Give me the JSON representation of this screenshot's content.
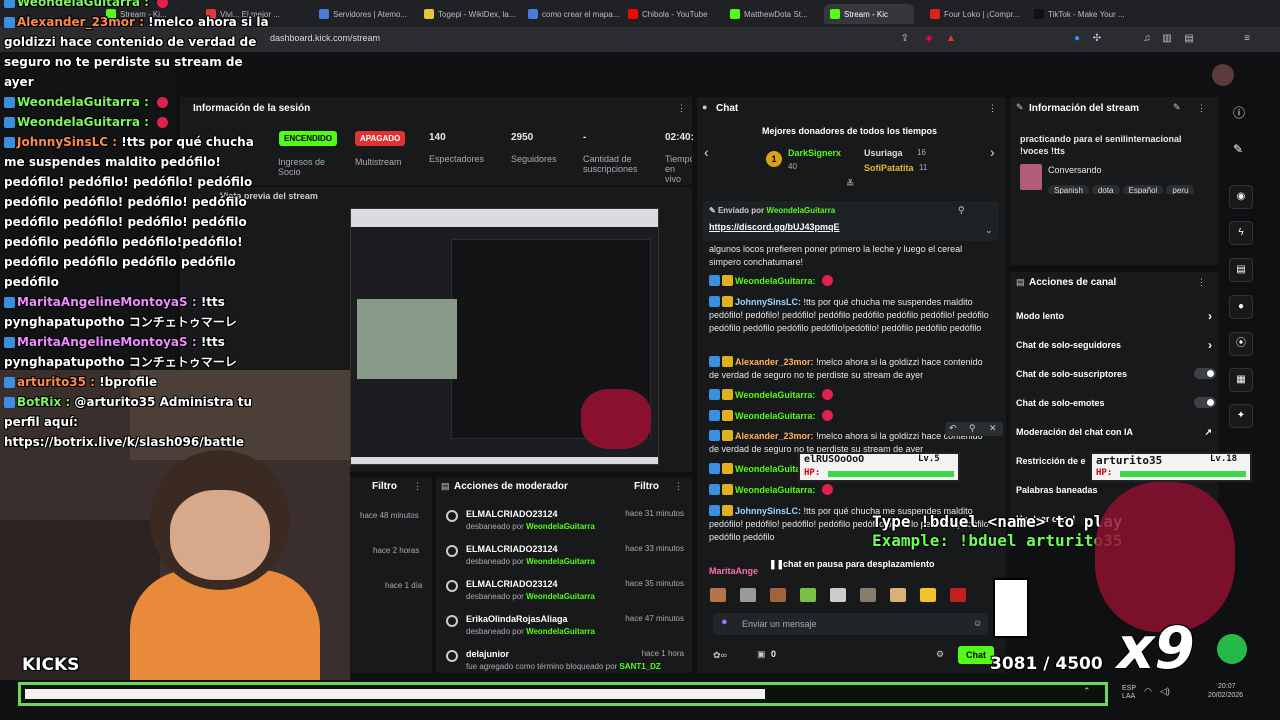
{
  "browser": {
    "tabs": [
      {
        "label": "Stream - Ki...",
        "fav": "#53fc18"
      },
      {
        "label": "Vivi... El mejor ...",
        "fav": "#e03a3a"
      },
      {
        "label": "Servidores | Atemo...",
        "fav": "#4a7bd9"
      },
      {
        "label": "Togepi - WikiDex, la...",
        "fav": "#e7c43a"
      },
      {
        "label": "como crear el mapa...",
        "fav": "#4a7bd9"
      },
      {
        "label": "Chibola - YouTube",
        "fav": "#ff0000"
      },
      {
        "label": "MatthewDota St...",
        "fav": "#53fc18"
      },
      {
        "label": "Stream - Kic",
        "fav": "#53fc18"
      },
      {
        "label": "Four Loko | ¡Compr...",
        "fav": "#d22"
      },
      {
        "label": "TikTok - Make Your ...",
        "fav": "#111"
      }
    ],
    "url": "dashboard.kick.com/stream"
  },
  "session": {
    "title": "Información de la sesión",
    "on_label": "ENCENDIDO",
    "off_label": "APAGADO",
    "stats": [
      {
        "value": "140",
        "label": "Espectadores"
      },
      {
        "value": "2950",
        "label": "Seguidores"
      },
      {
        "value": "-",
        "label": "Cantidad de suscripciones"
      },
      {
        "value": "02:40:",
        "label": "Tiempo en vivo"
      }
    ],
    "left_labels": [
      "Ingresos de Socio",
      "Multistream"
    ],
    "preview_title": "Vista previa del stream"
  },
  "activity": {
    "filter_label": "Filtro",
    "times": [
      "hace 48 minutos",
      "hace 2 horas",
      "hace 1 día"
    ]
  },
  "modactions": {
    "title": "Acciones de moderador",
    "filter_label": "Filtro",
    "rows": [
      {
        "name": "ELMALCRIADO23124",
        "sub": "desbaneado por",
        "by": "WeondelaGuitarra",
        "time": "hace 31 minutos"
      },
      {
        "name": "ELMALCRIADO23124",
        "sub": "desbaneado por",
        "by": "WeondelaGuitarra",
        "time": "hace 33 minutos"
      },
      {
        "name": "ELMALCRIADO23124",
        "sub": "desbaneado por",
        "by": "WeondelaGuitarra",
        "time": "hace 35 minutos"
      },
      {
        "name": "ErikaOlindaRojasAliaga",
        "sub": "desbaneado por",
        "by": "WeondelaGuitarra",
        "time": "hace 47 minutos"
      },
      {
        "name": "delajunior",
        "sub": "fue agregado como término bloqueado por",
        "by": "SANT1_DZ",
        "time": "hace 1 hora"
      }
    ]
  },
  "chat": {
    "title": "Chat",
    "donors_title": "Mejores donadores de todos los tiempos",
    "donors": [
      {
        "name": "DarkSignerx",
        "amount": "40"
      },
      {
        "name": "Usuriaga",
        "amount": "16"
      },
      {
        "name": "SofiPatatita",
        "amount": "11"
      }
    ],
    "pinned_by": "Enviado por",
    "pinned_user": "WeondelaGuitarra",
    "pinned_link": "https://discord.gg/bUJ43pmqE",
    "messages": [
      {
        "user": "",
        "text": "algunos locos prefieren poner primero la leche y luego el cereal simpero conchatumare!"
      },
      {
        "user": "WeondelaGuitarra:",
        "text": ""
      },
      {
        "user": "JohnnySinsLC:",
        "text": "!tts por qué chucha me suspendes maldito pedófilo! pedófilo! pedófilo! pedófilo pedófilo pedófilo pedófilo! pedófilo pedófilo pedófilo pedófilo pedófilo!pedófilo! pedófilo pedófilo pedófilo"
      },
      {
        "user": "Alexander_23mor:",
        "text": "!melco ahora si la goldizzi hace contenido de verdad de seguro no te perdiste su stream de ayer"
      },
      {
        "user": "WeondelaGuitarra:",
        "text": ""
      },
      {
        "user": "WeondelaGuitarra:",
        "text": ""
      },
      {
        "user": "Alexander_23mor:",
        "text": "!melco ahora si la goldizzi hace contenido de verdad de seguro no te perdiste su stream de ayer"
      },
      {
        "user": "WeondelaGuitarra:",
        "text": ""
      },
      {
        "user": "WeondelaGuitarra:",
        "text": ""
      },
      {
        "user": "JohnnySinsLC:",
        "text": "!tts por qué chucha me suspendes maldito pedófilo! pedófilo! pedófilo! pedófilo pedófilo pedófilo pedófilo! pedófilo pedófilo pedófilo"
      }
    ],
    "paused": "chat en pausa para desplazamiento",
    "last_user": "MaritaAnge",
    "input_placeholder": "Enviar un mensaje",
    "points": "0",
    "send_label": "Chat"
  },
  "stream_info": {
    "title": "Información del stream",
    "stream_title": "practicando para el senilinternacional !voces !tts",
    "category": "Conversando",
    "tags": [
      "Spanish",
      "dota",
      "Español",
      "peru"
    ]
  },
  "channel_actions": {
    "title": "Acciones de canal",
    "items": [
      {
        "label": "Modo lento",
        "control": "chevron"
      },
      {
        "label": "Chat de solo-seguidores",
        "control": "chevron"
      },
      {
        "label": "Chat de solo-suscriptores",
        "control": "toggle"
      },
      {
        "label": "Chat de solo-emotes",
        "control": "toggle"
      },
      {
        "label": "Moderación del chat con IA",
        "control": "link"
      },
      {
        "label": "Restricción de e",
        "control": "none"
      },
      {
        "label": "Palabras baneadas",
        "control": "none"
      },
      {
        "label": "Hostear canal",
        "control": "none"
      }
    ]
  },
  "overlay": {
    "lines": [
      {
        "user": "WeondelaGuitarra :",
        "text": ""
      },
      {
        "user": "Alexander_23mor :",
        "text": "!melco ahora si la goldizzi hace contenido de verdad de seguro no te perdiste su stream de ayer"
      },
      {
        "user": "WeondelaGuitarra :",
        "text": ""
      },
      {
        "user": "WeondelaGuitarra :",
        "text": ""
      },
      {
        "user": "JohnnySinsLC :",
        "text": "!tts por qué chucha me suspendes maldito pedófilo! pedófilo! pedófilo! pedófilo! pedófilo pedófilo pedófilo! pedófilo! pedófilo pedófilo pedófilo! pedófilo! pedófilo pedófilo pedófilo pedófilo!pedófilo! pedófilo pedófilo pedófilo pedófilo pedófilo"
      },
      {
        "user": "MaritaAngelineMontoyaS :",
        "text": "!tts pynghapatupotho コンチェトゥマーレ"
      },
      {
        "user": "MaritaAngelineMontoyaS :",
        "text": "!tts pynghapatupotho コンチェトゥマーレ"
      },
      {
        "user": "arturito35 :",
        "text": "!bprofile"
      },
      {
        "user": "BotRix :",
        "text": "@arturito35 Administra tu perfil aquí: https://botrix.live/k/slash096/battle"
      }
    ],
    "kicks_label": "KICKS",
    "duel_line1": "Type !bduel <name> to play",
    "duel_line2": "Example: !bduel arturito35",
    "hp_card_left": {
      "name": "elRUSOoOoO",
      "level": "Lv.5",
      "hp": "HP:"
    },
    "hp_card_right": {
      "name": "arturito35",
      "level": "Lv.18",
      "hp": "HP:"
    },
    "counter": "3081",
    "counter_max": "/ 4500",
    "multiplier": "x9"
  },
  "taskbar": {
    "time": "20:07",
    "date": "20/02/2026",
    "lang": "ESP LAA"
  }
}
